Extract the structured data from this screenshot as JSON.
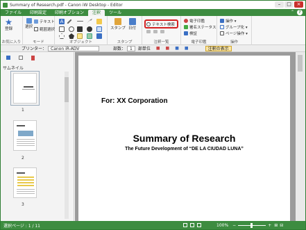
{
  "window": {
    "title": "Summary of Research.pdf - Canon iW Desktop - Editor"
  },
  "menu": {
    "tabs": [
      "ファイル",
      "印刷設定",
      "印刷オプション",
      "注釈",
      "ツール"
    ],
    "active_index": 3,
    "collapse": "⌃",
    "help": "?"
  },
  "ribbon": {
    "groups": {
      "favorites": "お気に入り",
      "mode": "モード",
      "object": "オブジェクト",
      "stamp": "スタンプ",
      "annotation_list": "注釈一覧",
      "digital_signature": "電子印鑑",
      "operation": "操作"
    },
    "register": "登録",
    "select_label": "選択",
    "text_box": "テキスト",
    "area_select": "範囲選択",
    "stamp": "スタンプ",
    "date": "日付",
    "text_search": "テキスト検索",
    "digital_seal": "電子印鑑",
    "signature_status": "署名ステータス",
    "verify": "検証",
    "ops": {
      "operate": "操作 ▾",
      "group": "グループ化 ▾",
      "page_ops": "ページ操作 ▾"
    }
  },
  "toolbar": {
    "printer_label": "プリンター：",
    "printer_value": "Canon iR-ADV",
    "copies_label": "部数：",
    "copies_value": "1",
    "sort_label": "部単位",
    "show_annotations": "注釈の表示"
  },
  "sidebar": {
    "header": "サムネイル",
    "thumbnails": [
      {
        "num": "1"
      },
      {
        "num": "2"
      },
      {
        "num": "3"
      }
    ]
  },
  "document": {
    "for_line": "For: XX Corporation",
    "title": "Summary of Research",
    "subtitle": "The Future Development of “DE LA CIUDAD LUNA”"
  },
  "status": {
    "page_label": "選択ページ : 1 / 11",
    "zoom": "100%"
  }
}
